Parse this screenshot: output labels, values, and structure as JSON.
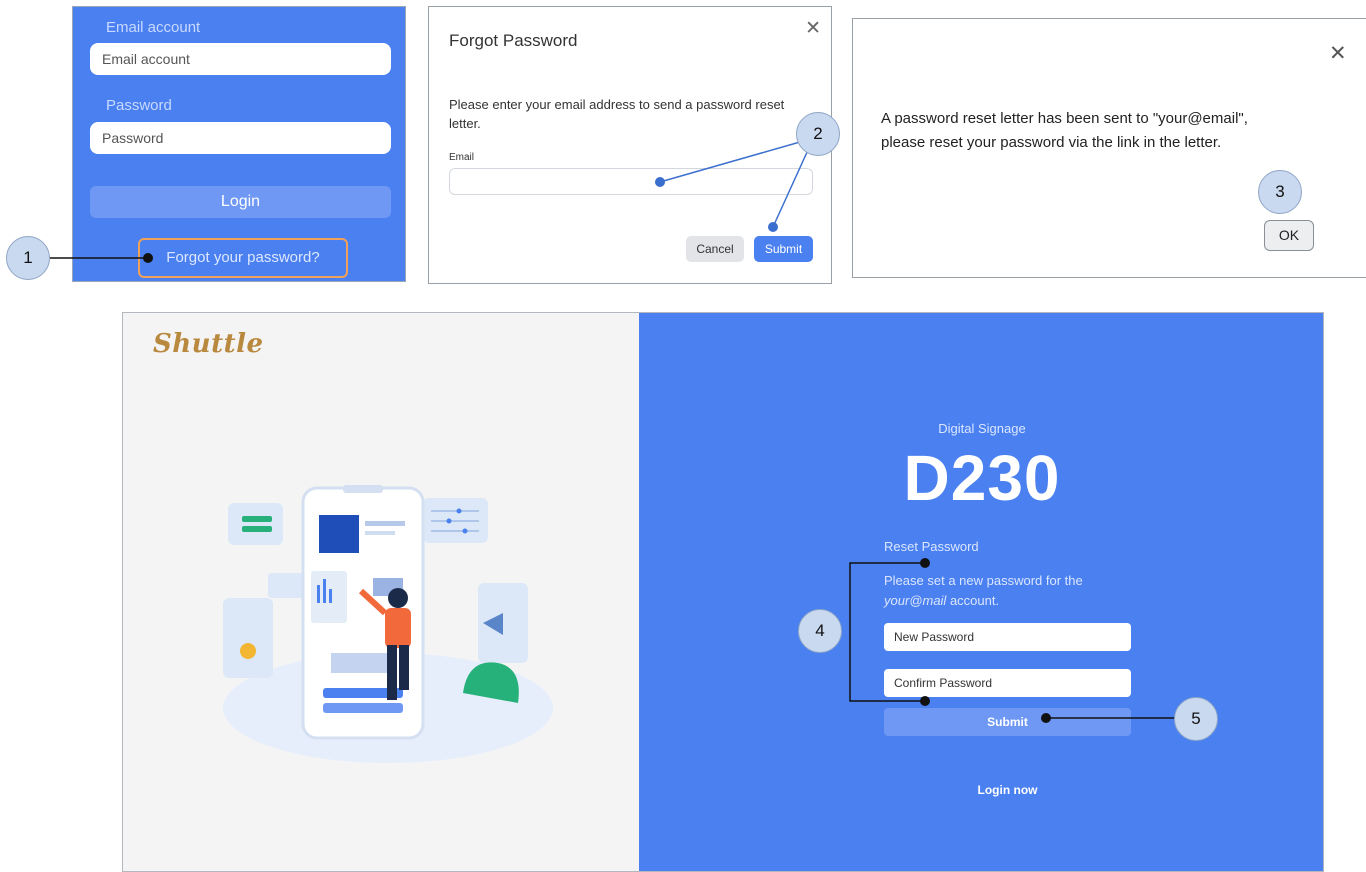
{
  "login_panel": {
    "email_label": "Email account",
    "email_placeholder": "Email account",
    "password_label": "Password",
    "password_placeholder": "Password",
    "login_button": "Login",
    "forgot_link": "Forgot your password?"
  },
  "forgot_dialog": {
    "title": "Forgot Password",
    "close": "✕",
    "message": "Please enter your email address to send a password reset letter.",
    "email_label": "Email",
    "email_value": "",
    "cancel_button": "Cancel",
    "submit_button": "Submit"
  },
  "sent_dialog": {
    "close": "✕",
    "message_line1": "A password reset letter has been sent to \"your@email\",",
    "message_line2": "please reset your password via the link in the letter.",
    "ok_button": "OK"
  },
  "main_page": {
    "logo": "Shuttle",
    "app_subtitle": "Digital Signage",
    "app_title": "D230",
    "reset_title": "Reset Password",
    "reset_message_prefix": "Please set a new password for the",
    "reset_message_email": "your@mail",
    "reset_message_suffix": " account.",
    "new_password_placeholder": "New Password",
    "confirm_password_placeholder": "Confirm Password",
    "submit_button": "Submit",
    "login_now": "Login now"
  },
  "callouts": [
    "1",
    "2",
    "3",
    "4",
    "5"
  ],
  "colors": {
    "brand_blue": "#4a80f0",
    "button_light_blue": "#6e98f4",
    "callout_fill": "#c9d9ef",
    "highlight_orange": "#f0a15a",
    "logo_gold": "#b9893f"
  }
}
